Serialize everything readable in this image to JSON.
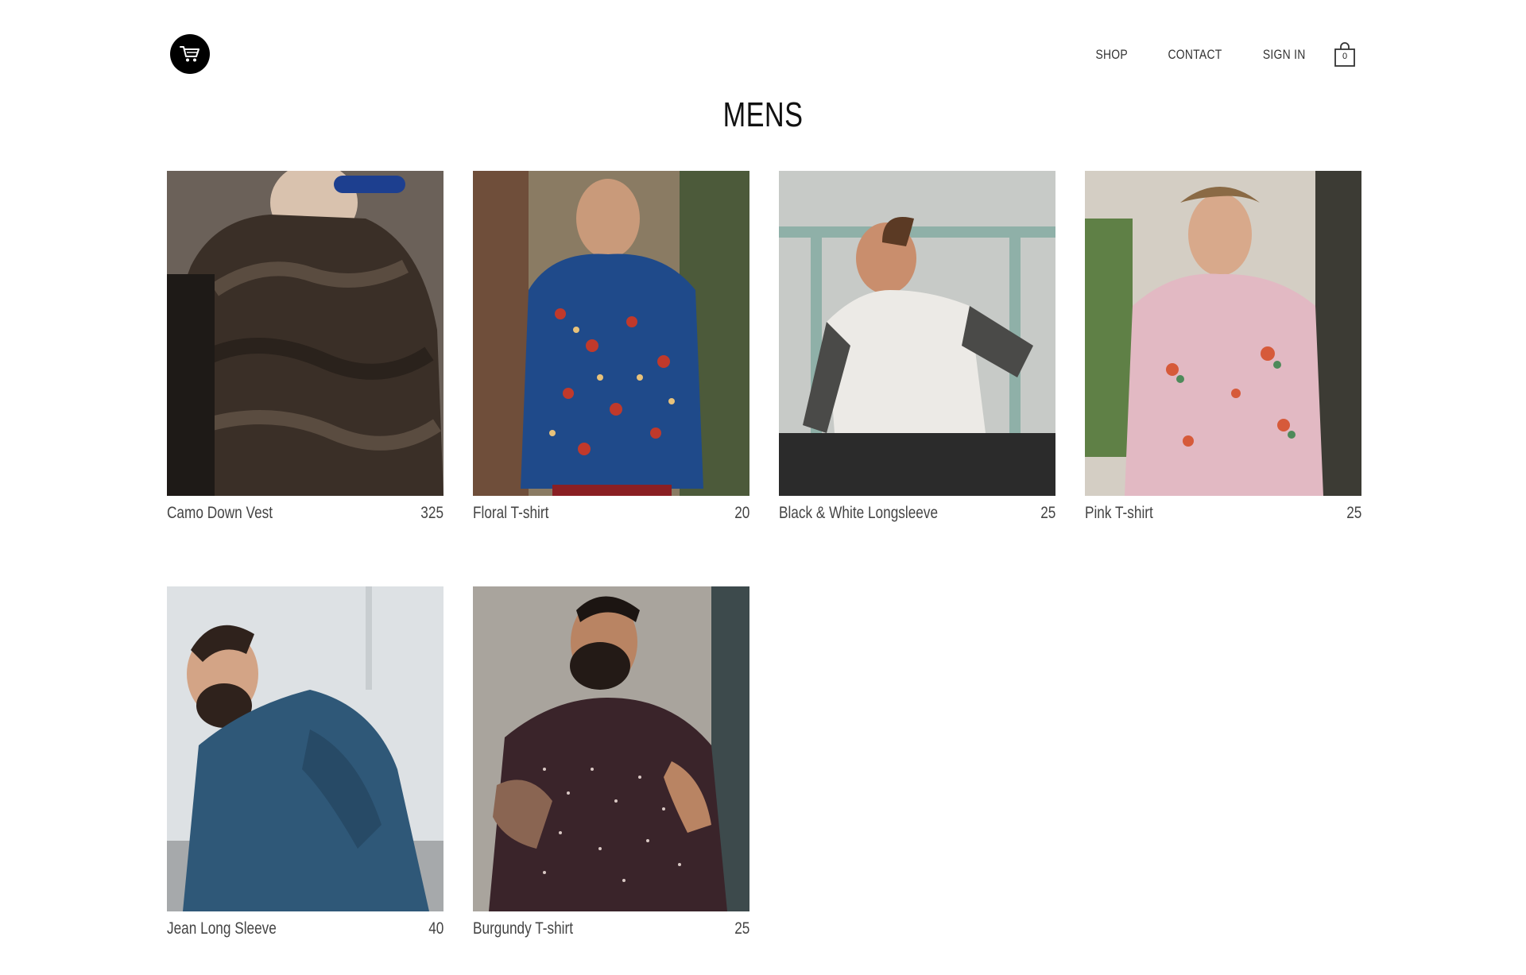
{
  "header": {
    "logo_icon": "cart-icon",
    "nav": [
      {
        "label": "SHOP"
      },
      {
        "label": "CONTACT"
      },
      {
        "label": "SIGN IN"
      }
    ],
    "bag": {
      "icon": "shopping-bag-icon",
      "count": "0"
    }
  },
  "page": {
    "title": "MENS"
  },
  "products": [
    {
      "name": "Camo Down Vest",
      "price": "325"
    },
    {
      "name": "Floral T-shirt",
      "price": "20"
    },
    {
      "name": "Black & White Longsleeve",
      "price": "25"
    },
    {
      "name": "Pink T-shirt",
      "price": "25"
    },
    {
      "name": "Jean Long Sleeve",
      "price": "40"
    },
    {
      "name": "Burgundy T-shirt",
      "price": "25"
    }
  ]
}
